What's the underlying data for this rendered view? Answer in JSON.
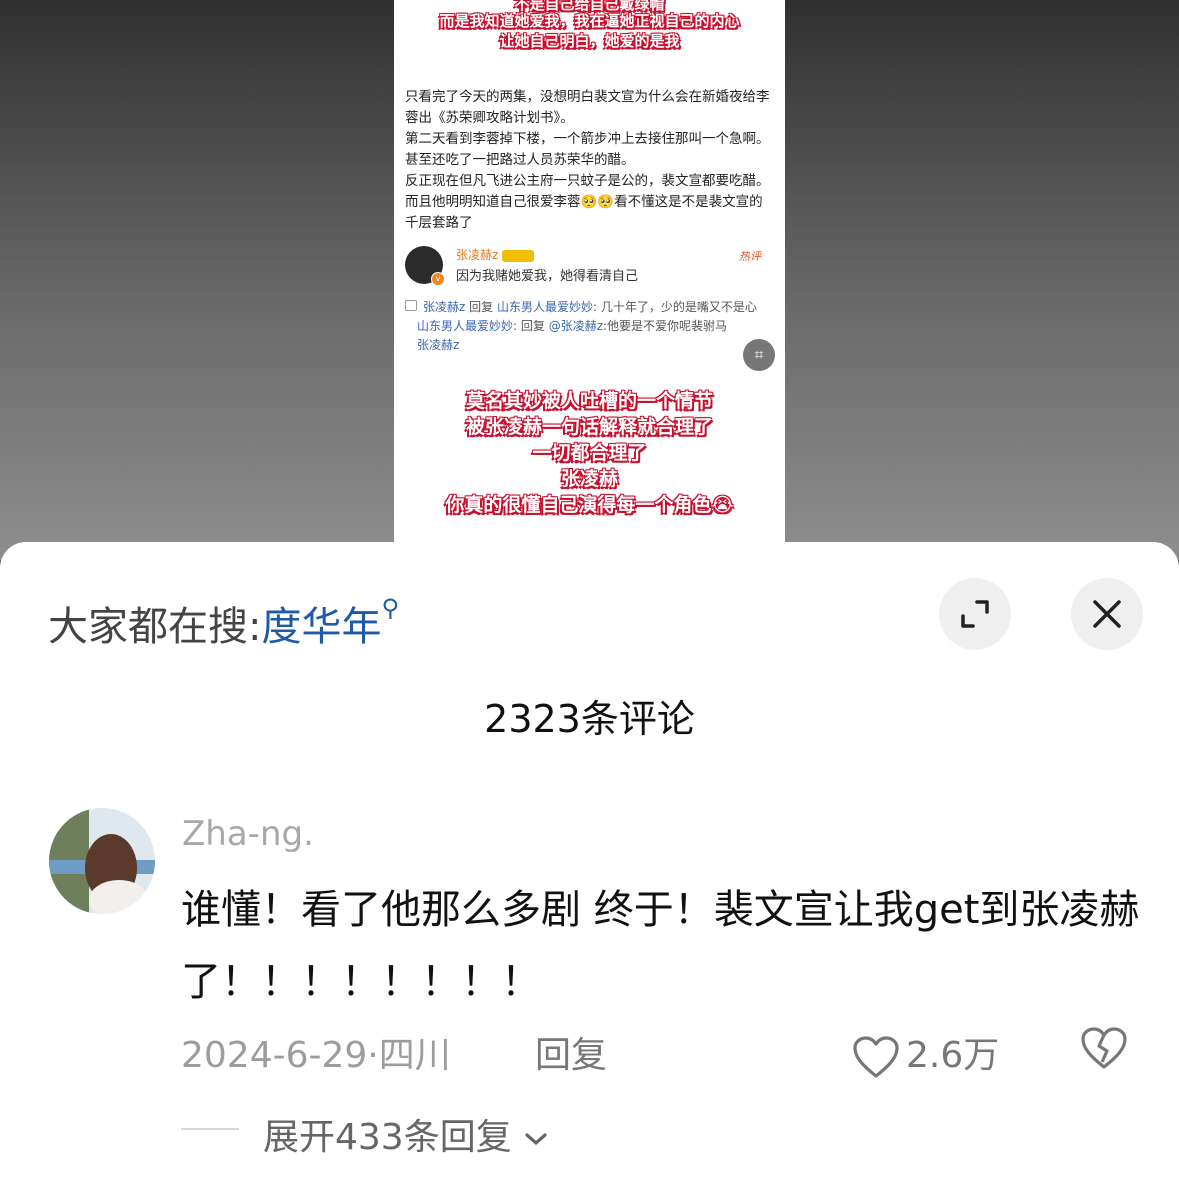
{
  "post": {
    "top_lines": [
      "不是自己给自己戴绿帽",
      "而是我知道她爱我，我在逼她正视自己的内心",
      "让她自己明白，她爱的是我"
    ],
    "body": [
      "只看完了今天的两集，没想明白裴文宣为什么会在新婚夜给李蓉出《苏荣卿攻略计划书》。",
      "第二天看到李蓉掉下楼，一个箭步冲上去接住那叫一个急啊。甚至还吃了一把路过人员苏荣华的醋。",
      "反正现在但凡飞进公主府一只蚊子是公的，裴文宣都要吃醋。而且他明明知道自己很爱李蓉🥺🥺看不懂这是不是裴文宣的千层套路了"
    ],
    "inserted_comment": {
      "name": "张凌赫z",
      "text": "因为我赌她爱我，她得看清自己",
      "tag": "热评"
    },
    "sub_replies": [
      {
        "from": "张凌赫z",
        "mid": " 回复 ",
        "to": "山东男人最爱妙妙",
        "text": ": 几十年了，少的是嘴又不是心"
      },
      {
        "from": "山东男人最爱妙妙",
        "mid": ": 回复 ",
        "to": "@张凌赫z",
        "text": ":他要是不爱你呢裴驸马",
        "tail": "张凌赫z"
      }
    ],
    "bottom_lines": [
      "莫名其妙被人吐槽的一个情节",
      "被张凌赫一句话解释就合理了",
      "一切都合理了",
      "张凌赫",
      "你真的很懂自己演得每一个角色😭"
    ]
  },
  "sheet": {
    "search_prefix": "大家都在搜:",
    "search_keyword": "度华年",
    "comment_count": "2323条评论",
    "comment": {
      "username": "Zha-ng.",
      "text": "谁懂！看了他那么多剧 终于！裴文宣让我get到张凌赫了！！！！！！！！",
      "date_location": "2024-6-29·四川",
      "reply_label": "回复",
      "likes": "2.6万"
    },
    "expand_label": "展开433条回复"
  },
  "icons": [
    "search-icon",
    "expand-icon",
    "close-icon",
    "heart-icon",
    "broken-heart-icon",
    "chevron-down-icon",
    "scan-icon"
  ],
  "colors": {
    "accent_blue": "#1e5aa8",
    "caption_red": "#c8102e"
  }
}
